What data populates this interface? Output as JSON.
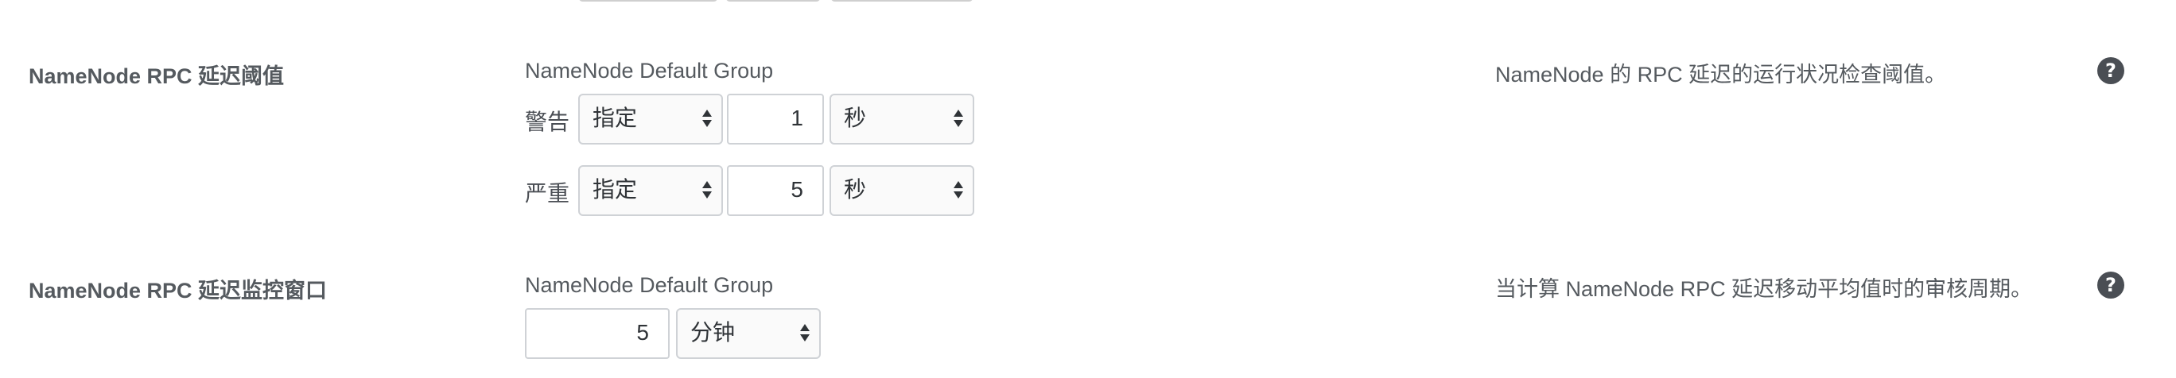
{
  "rows": [
    {
      "label": "NameNode RPC 延迟阈值",
      "group": "NameNode Default Group",
      "description": "NameNode 的 RPC 延迟的运行状况检查阈值。",
      "help": "?",
      "levels": [
        {
          "label": "警告",
          "mode": "指定",
          "value": "1",
          "unit": "秒"
        },
        {
          "label": "严重",
          "mode": "指定",
          "value": "5",
          "unit": "秒"
        }
      ]
    },
    {
      "label": "NameNode RPC 延迟监控窗口",
      "group": "NameNode Default Group",
      "description": "当计算 NameNode RPC 延迟移动平均值时的审核周期。",
      "help": "?",
      "value": "5",
      "unit": "分钟"
    }
  ]
}
